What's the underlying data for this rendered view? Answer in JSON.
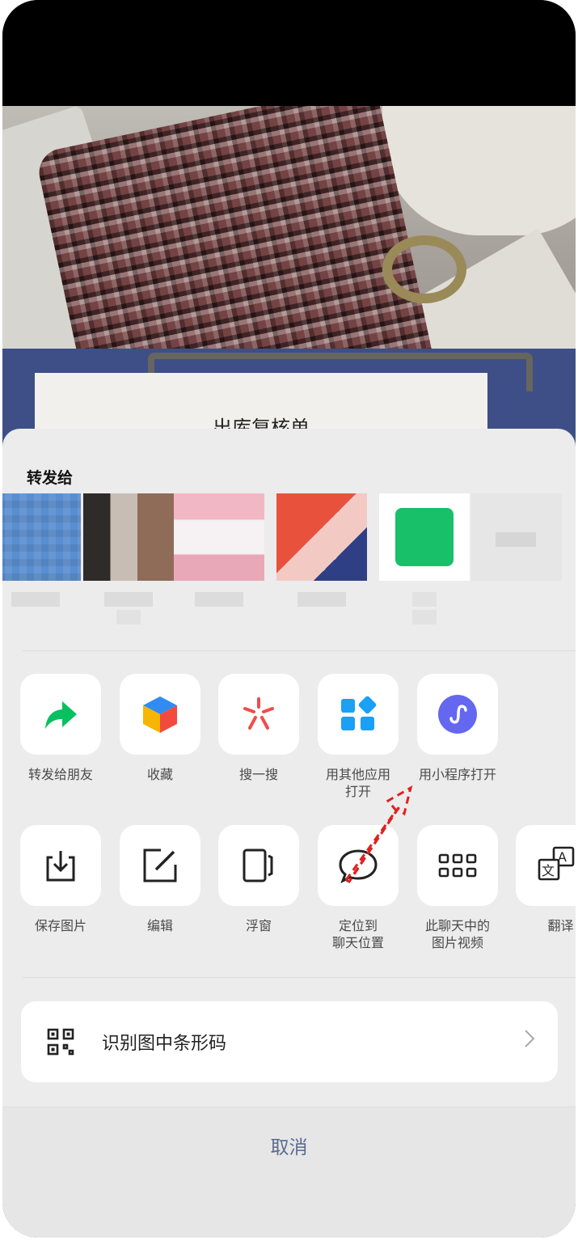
{
  "photo": {
    "label_text": "出库复核单"
  },
  "share": {
    "title": "转发给"
  },
  "actions_row1": [
    {
      "label": "转发给朋友",
      "icon": "forward-arrow-icon"
    },
    {
      "label": "收藏",
      "icon": "favorite-cube-icon"
    },
    {
      "label": "搜一搜",
      "icon": "search-sparkle-icon"
    },
    {
      "label": "用其他应用\n打开",
      "icon": "apps-grid-icon"
    },
    {
      "label": "用小程序打开",
      "icon": "mini-program-icon"
    }
  ],
  "actions_row2": [
    {
      "label": "保存图片",
      "icon": "download-icon"
    },
    {
      "label": "编辑",
      "icon": "edit-icon"
    },
    {
      "label": "浮窗",
      "icon": "floating-window-icon"
    },
    {
      "label": "定位到\n聊天位置",
      "icon": "chat-bubble-icon"
    },
    {
      "label": "此聊天中的\n图片视频",
      "icon": "media-grid-icon"
    },
    {
      "label": "翻译",
      "icon": "translate-icon"
    }
  ],
  "barcode": {
    "label": "识别图中条形码"
  },
  "cancel": {
    "label": "取消"
  },
  "colors": {
    "accent_blue": "#1aa0f5",
    "wechat_green": "#07c160",
    "purple": "#6467f0",
    "cancel_text": "#5a6b8f",
    "annotation_red": "#e02020"
  }
}
